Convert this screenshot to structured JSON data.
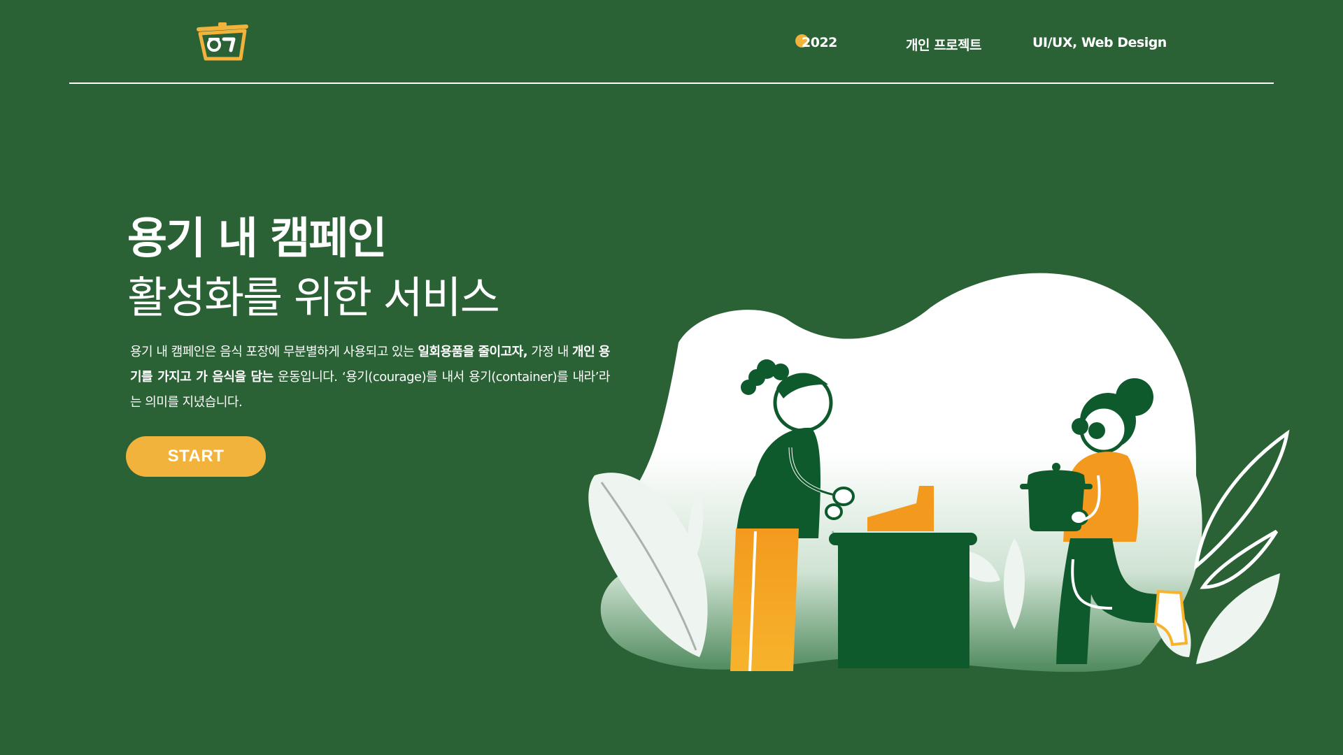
{
  "header": {
    "logo_name": "yonggi-container-logo",
    "nav": {
      "year": "2022",
      "project_type": "개인 프로젝트",
      "field": "UI/UX, Web Design"
    }
  },
  "hero": {
    "title_line1": "용기 내 캠페인",
    "title_line2": "활성화를 위한 서비스",
    "description": {
      "part1": "용기 내 캠페인은 음식 포장에 무분별하게 사용되고 있는 ",
      "bold1": "일회용품을 줄이고자,",
      "part2": " 가정 내 ",
      "bold2": "개인 용기를 가지고 가 음식을 담는",
      "part3": " 운동입니다. ‘용기(courage)를 내서 용기(container)를 내라’라는 의미를 지녔습니다."
    },
    "start_label": "START"
  },
  "colors": {
    "background": "#2a6135",
    "accent": "#f2b33d",
    "orange": "#f39a1e",
    "dark_green": "#0e5a2c",
    "white": "#ffffff"
  },
  "icons": {
    "logo": "pot-container-icon",
    "year_marker": "dot-icon"
  }
}
